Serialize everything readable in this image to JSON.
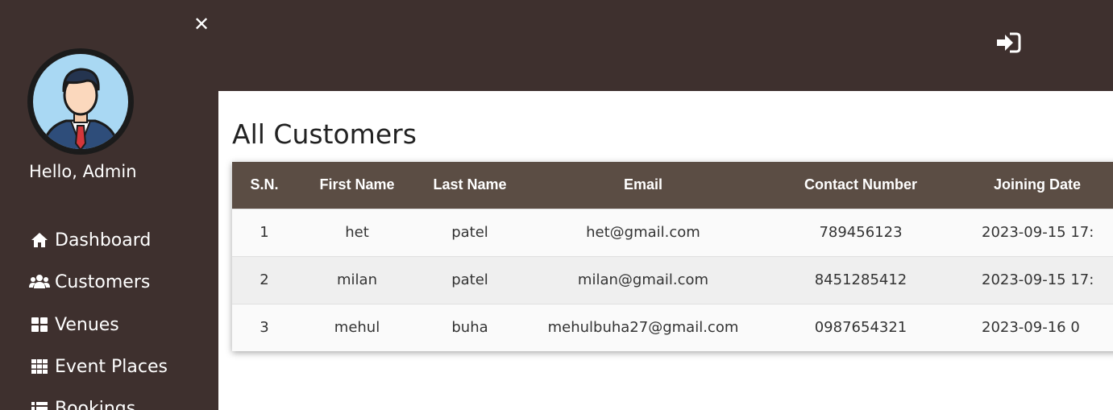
{
  "sidebar": {
    "greeting": "Hello, Admin",
    "items": [
      {
        "label": "Dashboard",
        "icon": "home-icon"
      },
      {
        "label": "Customers",
        "icon": "users-icon"
      },
      {
        "label": "Venues",
        "icon": "grid-large-icon"
      },
      {
        "label": "Event Places",
        "icon": "grid-small-icon"
      },
      {
        "label": "Bookings",
        "icon": "list-icon"
      }
    ]
  },
  "topbar": {
    "logout_icon": "sign-in-icon"
  },
  "main": {
    "title": "All Customers",
    "table": {
      "headers": [
        "S.N.",
        "First Name",
        "Last Name",
        "Email",
        "Contact Number",
        "Joining Date"
      ],
      "rows": [
        [
          "1",
          "het",
          "patel",
          "het@gmail.com",
          "789456123",
          "2023-09-15 17:"
        ],
        [
          "2",
          "milan",
          "patel",
          "milan@gmail.com",
          "8451285412",
          "2023-09-15 17:"
        ],
        [
          "3",
          "mehul",
          "buha",
          "mehulbuha27@gmail.com",
          "0987654321",
          "2023-09-16 0"
        ]
      ]
    }
  },
  "colors": {
    "sidebar_bg": "#3e302e",
    "table_header_bg": "#5b4d44",
    "main_bg": "#ffffff"
  }
}
